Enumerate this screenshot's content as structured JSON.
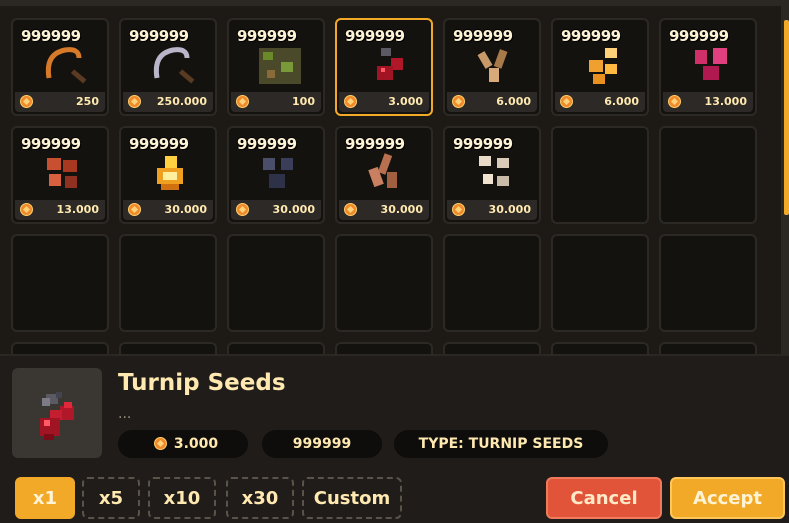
{
  "shop": {
    "slots": [
      {
        "qty": "999999",
        "price": "250",
        "icon": "sickle-copper-icon"
      },
      {
        "qty": "999999",
        "price": "250.000",
        "icon": "sickle-iron-icon"
      },
      {
        "qty": "999999",
        "price": "100",
        "icon": "moss-block-icon"
      },
      {
        "qty": "999999",
        "price": "3.000",
        "icon": "turnip-seeds-icon"
      },
      {
        "qty": "999999",
        "price": "6.000",
        "icon": "wheat-seeds-icon"
      },
      {
        "qty": "999999",
        "price": "6.000",
        "icon": "golden-seeds-icon"
      },
      {
        "qty": "999999",
        "price": "13.000",
        "icon": "pink-seeds-icon"
      },
      {
        "qty": "999999",
        "price": "13.000",
        "icon": "red-ore-icon"
      },
      {
        "qty": "999999",
        "price": "30.000",
        "icon": "fire-seeds-icon"
      },
      {
        "qty": "999999",
        "price": "30.000",
        "icon": "coal-seeds-icon"
      },
      {
        "qty": "999999",
        "price": "30.000",
        "icon": "copper-roots-icon"
      },
      {
        "qty": "999999",
        "price": "30.000",
        "icon": "bone-seeds-icon"
      }
    ],
    "selected_index": 3
  },
  "detail": {
    "name": "Turnip Seeds",
    "description": "...",
    "price": "3.000",
    "qty": "999999",
    "type": "TYPE: TURNIP SEEDS"
  },
  "multipliers": [
    "x1",
    "x5",
    "x10",
    "x30",
    "Custom"
  ],
  "active_multiplier": 0,
  "actions": {
    "cancel": "Cancel",
    "accept": "Accept"
  },
  "colors": {
    "accent": "#f2a928",
    "cancel": "#e2543a",
    "coin": "#f08a2a"
  }
}
